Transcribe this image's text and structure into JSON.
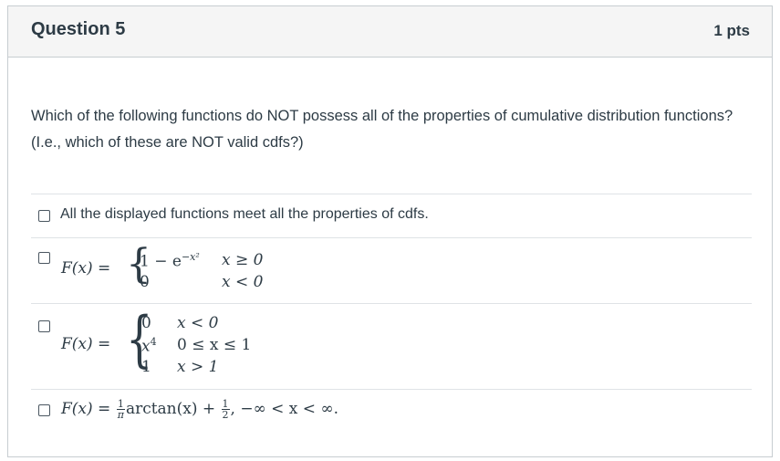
{
  "question": {
    "title": "Question 5",
    "points": "1 pts",
    "prompt": "Which of the following functions do NOT possess all of the properties of cumulative distribution functions?  (I.e., which of these are NOT valid cdfs?)"
  },
  "answers": [
    {
      "label": "All the displayed functions meet all the properties of cdfs.",
      "checked": false
    },
    {
      "lhs": "F(x) =",
      "cases": [
        {
          "expr": "1 − e",
          "exp": "−x²",
          "cond": "x ≥ 0"
        },
        {
          "expr": "0",
          "cond": "x < 0"
        }
      ],
      "checked": false
    },
    {
      "lhs": "F(x) =",
      "cases": [
        {
          "expr": "0",
          "cond": "x < 0"
        },
        {
          "expr": "x",
          "exp": "4",
          "cond": "0 ≤ x ≤ 1"
        },
        {
          "expr": "1",
          "cond": "x > 1"
        }
      ],
      "checked": false
    },
    {
      "lhs": "F(x) =",
      "frac1_num": "1",
      "frac1_den": "π",
      "mid": "arctan(x) +",
      "frac2_num": "1",
      "frac2_den": "2",
      "tail": ", −∞ < x < ∞.",
      "checked": false
    }
  ]
}
